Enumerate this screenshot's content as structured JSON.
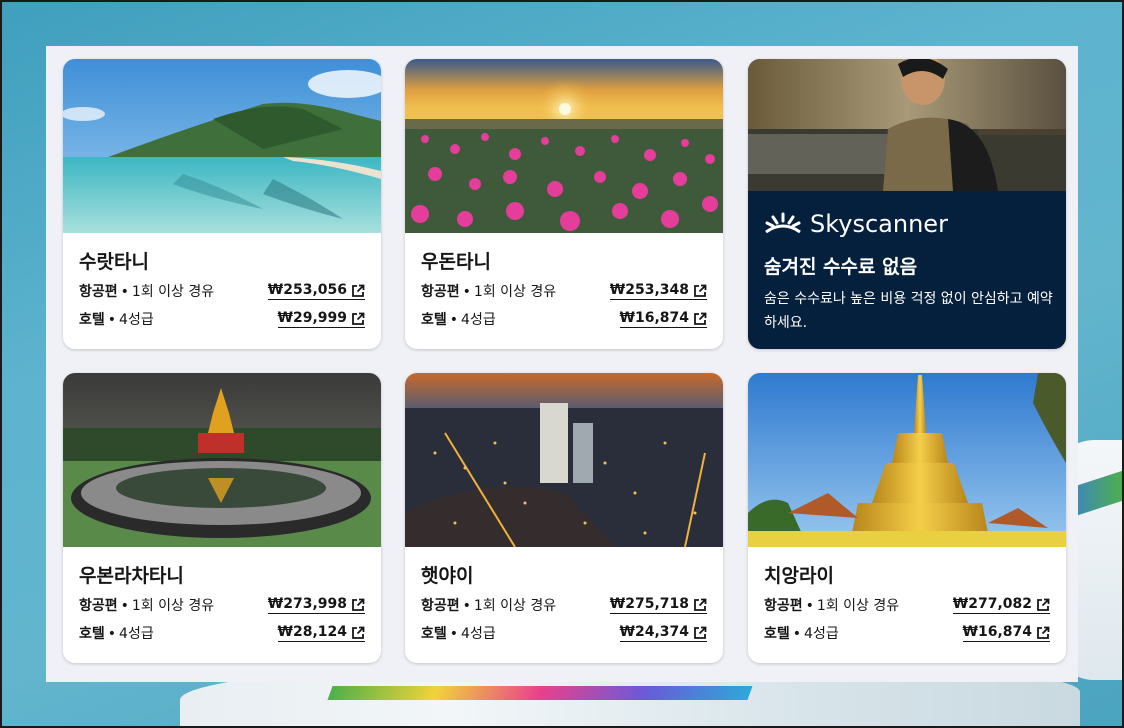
{
  "cards": [
    {
      "city": "수랏타니",
      "flight_label": "항공편",
      "flight_detail": "1회 이상 경유",
      "flight_price": "₩253,056",
      "hotel_label": "호텔",
      "hotel_detail": "4성급",
      "hotel_price": "₩29,999"
    },
    {
      "city": "우돈타니",
      "flight_label": "항공편",
      "flight_detail": "1회 이상 경유",
      "flight_price": "₩253,348",
      "hotel_label": "호텔",
      "hotel_detail": "4성급",
      "hotel_price": "₩16,874"
    },
    {
      "city": "우본라차타니",
      "flight_label": "항공편",
      "flight_detail": "1회 이상 경유",
      "flight_price": "₩273,998",
      "hotel_label": "호텔",
      "hotel_detail": "4성급",
      "hotel_price": "₩28,124"
    },
    {
      "city": "햇야이",
      "flight_label": "항공편",
      "flight_detail": "1회 이상 경유",
      "flight_price": "₩275,718",
      "hotel_label": "호텔",
      "hotel_detail": "4성급",
      "hotel_price": "₩24,374"
    },
    {
      "city": "치앙라이",
      "flight_label": "항공편",
      "flight_detail": "1회 이상 경유",
      "flight_price": "₩277,082",
      "hotel_label": "호텔",
      "hotel_detail": "4성급",
      "hotel_price": "₩16,874"
    }
  ],
  "promo": {
    "brand": "Skyscanner",
    "title": "숨겨진 수수료 없음",
    "text": "숨은 수수료나 높은 비용 걱정 없이 안심하고 예약하세요."
  },
  "separator": "•",
  "icons": {
    "external": "external-link-icon",
    "brand": "skyscanner-sun-icon"
  },
  "colors": {
    "promo_bg": "#05203c",
    "panel_bg": "#eff1f6",
    "text": "#161616"
  }
}
